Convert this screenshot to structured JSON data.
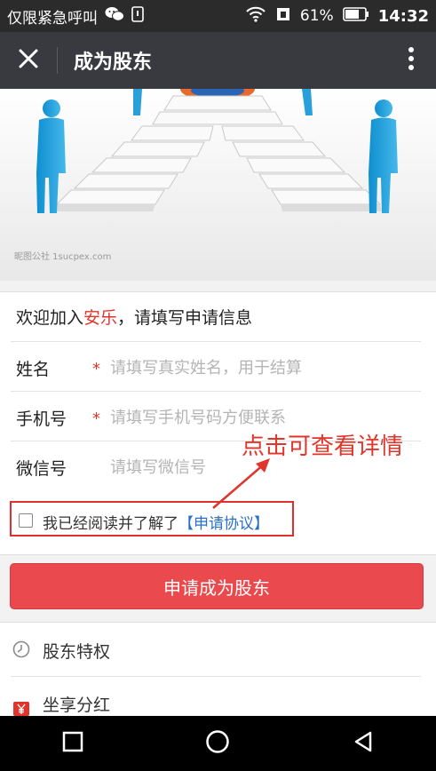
{
  "status_bar": {
    "carrier": "仅限紧急呼叫",
    "battery_percent": "61%",
    "time": "14:32",
    "icons": [
      "wechat-icon",
      "notification-icon",
      "wifi-icon",
      "sim-icon",
      "battery-icon"
    ]
  },
  "app_bar": {
    "title": "成为股东",
    "icons": [
      "close-icon",
      "more-vert-icon"
    ]
  },
  "banner": {
    "watermark": "昵图公社 1sucpex.com"
  },
  "form": {
    "welcome_prefix": "欢迎加入",
    "brand": "安乐",
    "welcome_suffix": "，请填写申请信息",
    "fields": [
      {
        "label": "姓名",
        "required": true,
        "placeholder": "请填写真实姓名，用于结算",
        "value": ""
      },
      {
        "label": "手机号",
        "required": true,
        "placeholder": "请填写手机号码方便联系",
        "value": ""
      },
      {
        "label": "微信号",
        "required": false,
        "placeholder": "请填写微信号",
        "value": ""
      }
    ],
    "required_mark": "*"
  },
  "agreement": {
    "text": "我已经阅读并了解了",
    "link": "【申请协议】",
    "checked": false
  },
  "annotation": {
    "text": "点击可查看详情"
  },
  "submit_label": "申请成为股东",
  "perks": [
    {
      "label": "股东特权",
      "icon": "clock-circle-icon"
    },
    {
      "label": "坐享分红",
      "icon": "yen-icon"
    }
  ],
  "nav": {
    "icons": [
      "recents-square-icon",
      "home-circle-icon",
      "back-triangle-icon"
    ]
  },
  "colors": {
    "accent_red": "#e0352b",
    "button_red": "#ea4a4d",
    "link_blue": "#2a6fc9",
    "appbar": "#393a3f"
  }
}
